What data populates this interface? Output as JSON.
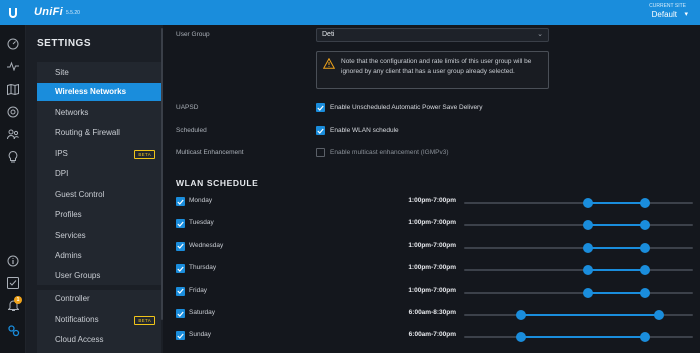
{
  "header": {
    "brand": "UniFi",
    "version": "5.5.20",
    "site_caption": "CURRENT SITE",
    "site_name": "Default"
  },
  "rail": {
    "notification_count": "1",
    "icons": [
      "dashboard-icon",
      "statistics-icon",
      "map-icon",
      "devices-icon",
      "clients-icon",
      "insights-icon",
      "info-icon",
      "events-icon",
      "alerts-icon",
      "settings-icon"
    ]
  },
  "sidebar": {
    "title": "SETTINGS",
    "items": [
      {
        "label": "Site"
      },
      {
        "label": "Wireless Networks",
        "active": true
      },
      {
        "label": "Networks"
      },
      {
        "label": "Routing & Firewall"
      },
      {
        "label": "IPS",
        "badge": "BETA"
      },
      {
        "label": "DPI"
      },
      {
        "label": "Guest Control"
      },
      {
        "label": "Profiles"
      },
      {
        "label": "Services"
      },
      {
        "label": "Admins"
      },
      {
        "label": "User Groups"
      }
    ],
    "bottom_items": [
      {
        "label": "Controller"
      },
      {
        "label": "Notifications",
        "badge": "BETA"
      },
      {
        "label": "Cloud Access"
      }
    ]
  },
  "form": {
    "user_group_label": "User Group",
    "user_group_value": "Deti",
    "notice": "Note that the configuration and rate limits of this user group will be ignored by any client that has a user group already selected.",
    "uapsd_label": "UAPSD",
    "uapsd_option": "Enable Unscheduled Automatic Power Save Delivery",
    "uapsd_checked": true,
    "scheduled_label": "Scheduled",
    "scheduled_option": "Enable WLAN schedule",
    "scheduled_checked": true,
    "multicast_label": "Multicast Enhancement",
    "multicast_option": "Enable multicast enhancement (IGMPv3)",
    "multicast_checked": false
  },
  "schedule": {
    "title": "WLAN SCHEDULE",
    "days": [
      {
        "day": "Monday",
        "time": "1:00pm-7:00pm",
        "start": 0.54,
        "end": 0.79
      },
      {
        "day": "Tuesday",
        "time": "1:00pm-7:00pm",
        "start": 0.54,
        "end": 0.79
      },
      {
        "day": "Wednesday",
        "time": "1:00pm-7:00pm",
        "start": 0.54,
        "end": 0.79
      },
      {
        "day": "Thursday",
        "time": "1:00pm-7:00pm",
        "start": 0.54,
        "end": 0.79
      },
      {
        "day": "Friday",
        "time": "1:00pm-7:00pm",
        "start": 0.54,
        "end": 0.79
      },
      {
        "day": "Saturday",
        "time": "6:00am-8:30pm",
        "start": 0.25,
        "end": 0.85
      },
      {
        "day": "Sunday",
        "time": "6:00am-7:00pm",
        "start": 0.25,
        "end": 0.79
      }
    ]
  },
  "colors": {
    "accent": "#1a8ddc",
    "beta": "#f0c419",
    "warning": "#f0a31a"
  }
}
